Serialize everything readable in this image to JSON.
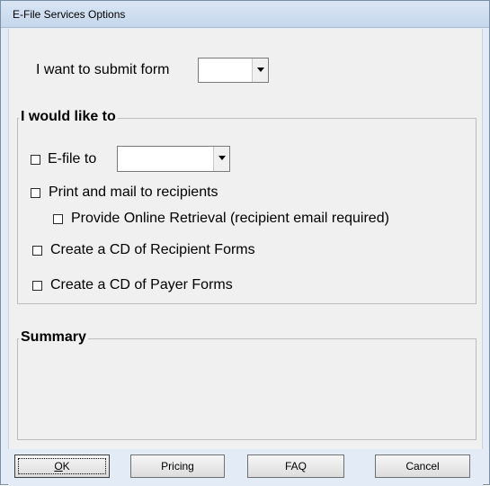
{
  "window": {
    "title": "E-File Services Options"
  },
  "submit": {
    "label": "I want to submit form",
    "selected_form": ""
  },
  "options_group": {
    "title": "I would like to",
    "efile_label": "E-file to",
    "efile_target": "",
    "print_mail_label": "Print and mail to recipients",
    "online_retrieval_label": "Provide Online Retrieval  (recipient email required)",
    "cd_recipient_label": "Create a CD of Recipient Forms",
    "cd_payer_label": "Create a CD of Payer Forms",
    "checked": {
      "efile": false,
      "print_mail": false,
      "online_retrieval": false,
      "cd_recipient": false,
      "cd_payer": false
    }
  },
  "summary_group": {
    "title": "Summary",
    "text": ""
  },
  "buttons": {
    "ok": "OK",
    "pricing": "Pricing",
    "faq": "FAQ",
    "cancel": "Cancel"
  }
}
